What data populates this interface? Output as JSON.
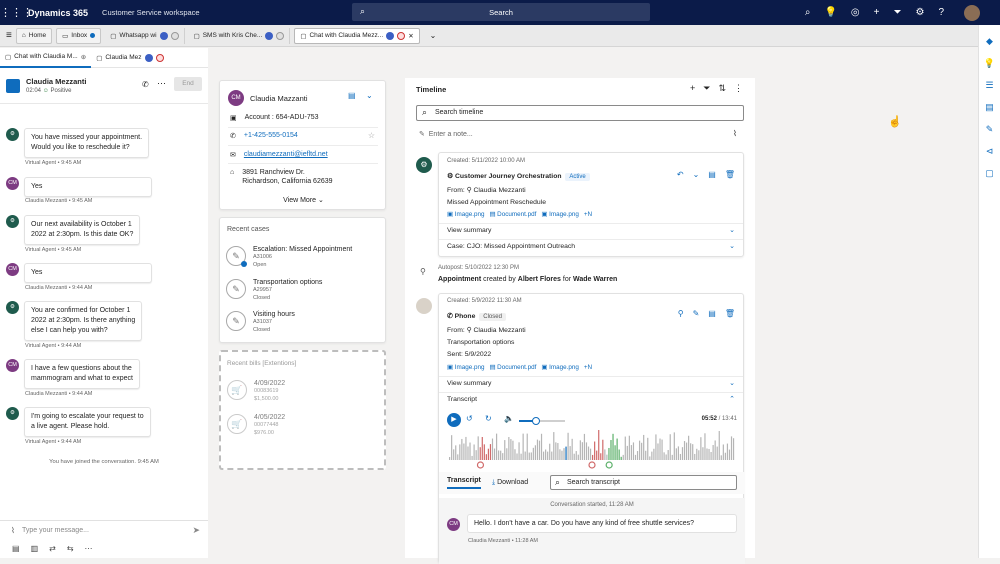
{
  "topbar": {
    "app": "Dynamics 365",
    "workspace": "Customer Service workspace",
    "search": "Search"
  },
  "tabs": [
    {
      "label": "Home"
    },
    {
      "label": "Inbox"
    },
    {
      "label": "Whatsapp wi"
    },
    {
      "label": "SMS with Kris Che..."
    },
    {
      "label": "Chat with Claudia Mezz..."
    }
  ],
  "subtabs": [
    {
      "label": "Chat with Claudia M..."
    },
    {
      "label": "Claudia Mez"
    }
  ],
  "chat": {
    "name": "Claudia Mezzanti",
    "time": "02:04",
    "sentiment": "Positive",
    "end": "End",
    "messages": [
      {
        "text1": "You have missed your appointment.",
        "text2": "Would you like to reschedule it?",
        "meta": "Virtual Agent • 9:45 AM"
      },
      {
        "text1": "Yes",
        "meta": "Claudia Mezzanti • 9:45 AM"
      },
      {
        "text1": "Our next availability is October 1",
        "text2": "2022 at 2:30pm. Is this date OK?",
        "meta": "Virtual Agent • 9:45 AM"
      },
      {
        "text1": "Yes",
        "meta": "Claudia Mezzanti • 9:44 AM"
      },
      {
        "text1": "You are confirmed for October 1",
        "text2": "2022 at 2:30pm. Is there anything",
        "text3": "else I can help you with?",
        "meta": "Virtual Agent • 9:44 AM"
      },
      {
        "text1": "I have a few questions about the",
        "text2": "mammogram and what to expect",
        "meta": "Claudia Mezzanti • 9:44 AM"
      },
      {
        "text1": "I'm going to escalate your request to",
        "text2": "a live agent. Please hold.",
        "meta": "Virtual Agent • 9:44 AM"
      }
    ],
    "joined": "You have joined the conversation. 9:45 AM",
    "placeholder": "Type your message..."
  },
  "contact": {
    "initials": "CM",
    "name": "Claudia Mazzanti",
    "account": "Account : 654-ADU-753",
    "phone": "+1-425-555-0154",
    "email": "claudiamezzanti@iefltd.net",
    "address1": "3891 Ranchview Dr.",
    "address2": "Richardson, California 62639",
    "view_more": "View More"
  },
  "recent_cases": {
    "title": "Recent cases",
    "items": [
      {
        "title": "Escalation: Missed Appointment",
        "id": "A31006",
        "status": "Open"
      },
      {
        "title": "Transportation options",
        "id": "A29957",
        "status": "Closed"
      },
      {
        "title": "Visiting hours",
        "id": "A31037",
        "status": "Closed"
      }
    ]
  },
  "recent_bills": {
    "title": "Recent bills [Extentions]",
    "items": [
      {
        "date": "4/09/2022",
        "id": "00083619",
        "amount": "$1,500.00"
      },
      {
        "date": "4/05/2022",
        "id": "00077448",
        "amount": "$976.00"
      }
    ]
  },
  "timeline": {
    "title": "Timeline",
    "search": "Search timeline",
    "note": "Enter a note...",
    "entry1": {
      "created": "Created: 5/11/2022 10:00 AM",
      "type": "Customer Journey Orchestration",
      "badge": "Active",
      "from_label": "From:",
      "from": "Claudia Mezzanti",
      "subject": "Missed Appointment Reschedule",
      "attachments": [
        "Image.png",
        "Document.pdf",
        "Image.png",
        "+N"
      ],
      "view_summary": "View summary",
      "case": "Case: CJO: Missed Appointment Outreach"
    },
    "autopost": {
      "line1": "Autopost: 5/10/2022 12:30 PM",
      "prefix": "Appointment",
      "mid": "created by",
      "by": "Albert Flores",
      "for": "for",
      "target": "Wade Warren"
    },
    "entry2": {
      "created": "Created: 5/9/2022 11:30 AM",
      "type": "Phone",
      "badge": "Closed",
      "from_label": "From:",
      "from": "Claudia Mezzanti",
      "subject": "Transportation options",
      "sent": "Sent: 5/9/2022",
      "attachments": [
        "Image.png",
        "Document.pdf",
        "Image.png",
        "+N"
      ],
      "view_summary": "View summary",
      "transcript": "Transcript",
      "time": "05:52",
      "total": "/ 13:41",
      "tab_transcript": "Transcript",
      "download": "Download",
      "search_transcript": "Search transcript",
      "started": "Conversation started, 11:28 AM",
      "msg": "Hello. I don't have a car. Do you have any kind of free shuttle services?",
      "msg_meta": "Claudia Mezzanti • 11:28 AM",
      "playback_progress": 0.41
    }
  },
  "colors": {
    "nav": "#0b1b49",
    "accent": "#0f6cbd",
    "bot": "#1f5b4d",
    "customer": "#7d3b82"
  }
}
